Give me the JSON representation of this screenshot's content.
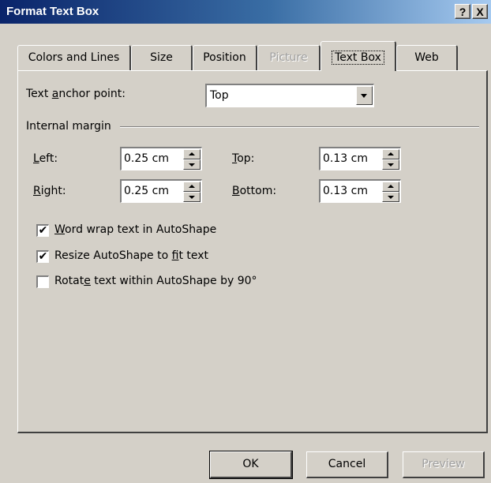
{
  "window": {
    "title": "Format Text Box",
    "help_label": "?",
    "close_label": "X"
  },
  "tabs": [
    {
      "label": "Colors and Lines",
      "state": "normal"
    },
    {
      "label": "Size",
      "state": "normal"
    },
    {
      "label": "Position",
      "state": "normal"
    },
    {
      "label": "Picture",
      "state": "disabled"
    },
    {
      "label": "Text Box",
      "state": "active"
    },
    {
      "label": "Web",
      "state": "normal"
    }
  ],
  "anchor": {
    "label_pre": "Text ",
    "label_key": "a",
    "label_post": "nchor point:",
    "value": "Top"
  },
  "internal_margin": {
    "title": "Internal margin",
    "left": {
      "label_key": "L",
      "label_post": "eft:",
      "value": "0.25 cm"
    },
    "right": {
      "label_key": "R",
      "label_post": "ight:",
      "value": "0.25 cm"
    },
    "top": {
      "label_key": "T",
      "label_post": "op:",
      "value": "0.13 cm"
    },
    "bottom": {
      "label_key": "B",
      "label_post": "ottom:",
      "value": "0.13 cm"
    }
  },
  "options": [
    {
      "pre": "",
      "key": "W",
      "post": "ord wrap text in AutoShape",
      "checked": true
    },
    {
      "pre": "Resize AutoShape to ",
      "key": "f",
      "post": "it text",
      "checked": true
    },
    {
      "pre": "Rotat",
      "key": "e",
      "post": " text within AutoShape by 90°",
      "checked": false
    }
  ],
  "buttons": {
    "ok": "OK",
    "cancel": "Cancel",
    "preview": "Preview"
  },
  "colors": {
    "face": "#d4d0c8",
    "title_start": "#0a246a",
    "title_end": "#a6caf0",
    "disabled_text": "#a0a0a0"
  }
}
